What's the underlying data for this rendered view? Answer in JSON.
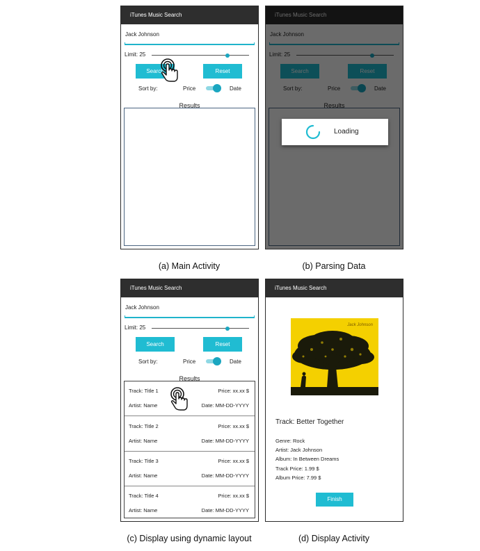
{
  "app": {
    "title": "iTunes Music Search",
    "search_value": "Jack Johnson",
    "limit_label": "Limit: 25",
    "search_button": "Search",
    "reset_button": "Reset",
    "sort_label": "Sort by:",
    "price_label": "Price",
    "date_label": "Date",
    "results_title": "Results",
    "slider_level": 0.78,
    "toggle_state": "on"
  },
  "loading": {
    "text": "Loading"
  },
  "results": [
    {
      "track": "Track: Title 1",
      "price": "Price: xx.xx $",
      "artist": "Artist: Name",
      "date": "Date: MM-DD-YYYY"
    },
    {
      "track": "Track: Title 2",
      "price": "Price: xx.xx $",
      "artist": "Artist: Name",
      "date": "Date: MM-DD-YYYY"
    },
    {
      "track": "Track: Title 3",
      "price": "Price: xx.xx $",
      "artist": "Artist: Name",
      "date": "Date: MM-DD-YYYY"
    },
    {
      "track": "Track: Title 4",
      "price": "Price: xx.xx $",
      "artist": "Artist: Name",
      "date": "Date: MM-DD-YYYY"
    }
  ],
  "detail": {
    "album_art_text": "Jack Johnson",
    "track": "Track: Better Together",
    "genre": "Genre: Rock",
    "artist": "Artist: Jack Johnson",
    "album": "Album: In Between Dreams",
    "track_price": "Track Price: 1.99 $",
    "album_price": "Album Price: 7.99 $",
    "finish_button": "Finish"
  },
  "captions": {
    "a": "(a) Main Activity",
    "b": "(b) Parsing Data",
    "c": "(c) Display using dynamic layout",
    "d": "(d) Display Activity"
  },
  "colors": {
    "accent": "#20bcd2",
    "appbar": "#2e2e2e",
    "album_bg": "#f4d000"
  },
  "icons": [
    "hand-pointer-icon",
    "spinner-icon"
  ]
}
